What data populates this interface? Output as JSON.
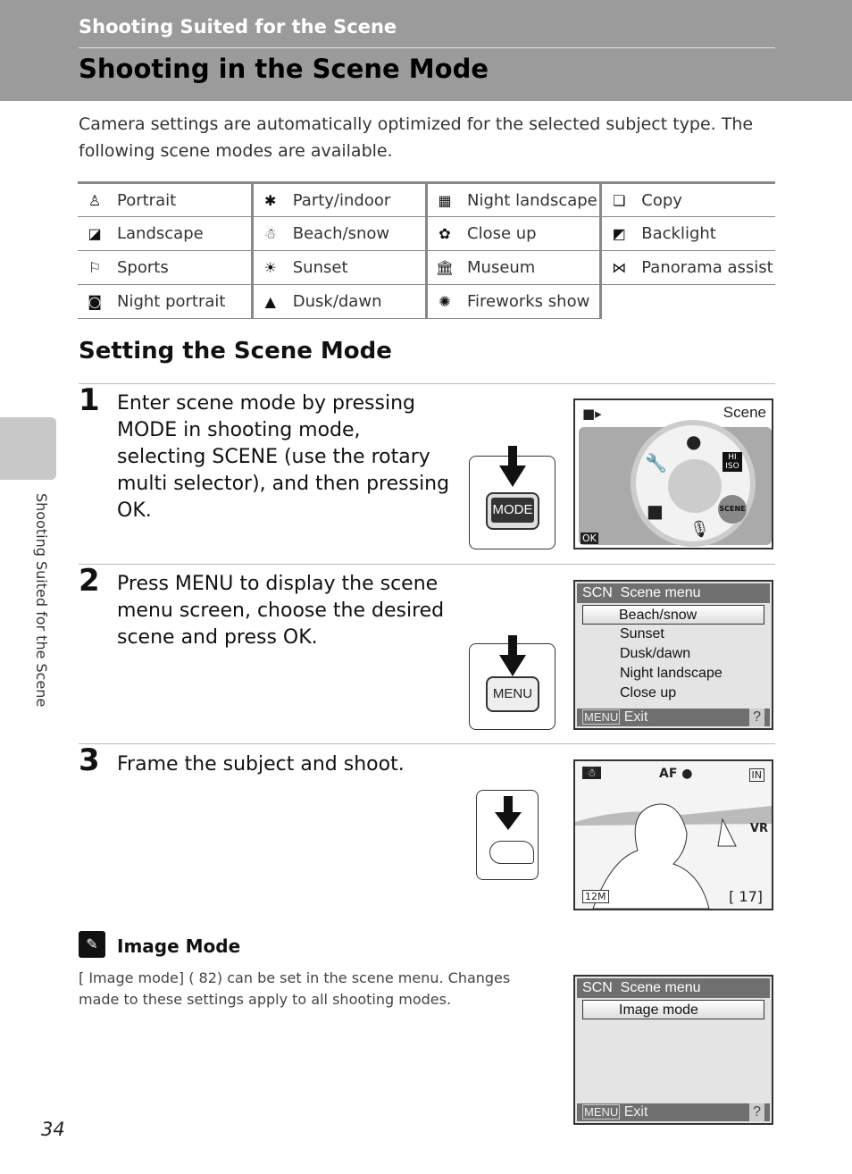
{
  "header": {
    "section": "Shooting Suited for the Scene",
    "title": "Shooting in the Scene Mode"
  },
  "intro": "Camera settings are automatically optimized for the selected subject type. The following scene modes are available.",
  "scene_modes": [
    [
      {
        "icon": "portrait-icon",
        "glyph": "♙",
        "label": "Portrait"
      },
      {
        "icon": "party-icon",
        "glyph": "✱",
        "label": "Party/indoor"
      },
      {
        "icon": "night-landscape-icon",
        "glyph": "▦",
        "label": "Night landscape"
      },
      {
        "icon": "copy-icon",
        "glyph": "❏",
        "label": "Copy"
      }
    ],
    [
      {
        "icon": "landscape-icon",
        "glyph": "◪",
        "label": "Landscape"
      },
      {
        "icon": "beach-snow-icon",
        "glyph": "☃",
        "label": "Beach/snow"
      },
      {
        "icon": "close-up-icon",
        "glyph": "✿",
        "label": "Close up"
      },
      {
        "icon": "backlight-icon",
        "glyph": "◩",
        "label": "Backlight"
      }
    ],
    [
      {
        "icon": "sports-icon",
        "glyph": "⚐",
        "label": "Sports"
      },
      {
        "icon": "sunset-icon",
        "glyph": "☀",
        "label": "Sunset"
      },
      {
        "icon": "museum-icon",
        "glyph": "🏛",
        "label": "Museum"
      },
      {
        "icon": "panorama-assist-icon",
        "glyph": "⋈",
        "label": "Panorama assist"
      }
    ],
    [
      {
        "icon": "night-portrait-icon",
        "glyph": "◙",
        "label": "Night portrait"
      },
      {
        "icon": "dusk-dawn-icon",
        "glyph": "▲",
        "label": "Dusk/dawn"
      },
      {
        "icon": "fireworks-icon",
        "glyph": "✺",
        "label": "Fireworks show"
      },
      null
    ]
  ],
  "section_title": "Setting the Scene Mode",
  "steps": [
    {
      "number": "1",
      "text": "Enter scene mode by pressing MODE in shooting mode, selecting SCENE (use the rotary multi selector), and then pressing OK.",
      "button": "MODE"
    },
    {
      "number": "2",
      "text": "Press MENU to display the scene menu screen, choose the desired scene and press OK.",
      "button": "MENU"
    },
    {
      "number": "3",
      "text": "Frame the subject and shoot."
    }
  ],
  "screen1": {
    "label": "Scene",
    "ok": "OK",
    "hiiso": "HI ISO",
    "scene": "SCENE"
  },
  "screen2": {
    "title": "Scene menu",
    "badge": "SCN",
    "items": [
      "Beach/snow",
      "Sunset",
      "Dusk/dawn",
      "Night landscape",
      "Close up"
    ],
    "footer_menu": "MENU",
    "footer": "Exit",
    "help": "?"
  },
  "screen3": {
    "af": "AF",
    "vr": "VR",
    "size": "12M",
    "remaining": "[ 17]"
  },
  "note": {
    "title": "Image Mode",
    "text": "[ Image mode] ( 82) can be set in the scene menu. Changes made to these settings apply to all shooting modes."
  },
  "screen4": {
    "title": "Scene menu",
    "badge": "SCN",
    "items": [
      "Image mode"
    ],
    "footer_menu": "MENU",
    "footer": "Exit",
    "help": "?"
  },
  "side_tab": "Shooting Suited for the Scene",
  "page_number": "34"
}
